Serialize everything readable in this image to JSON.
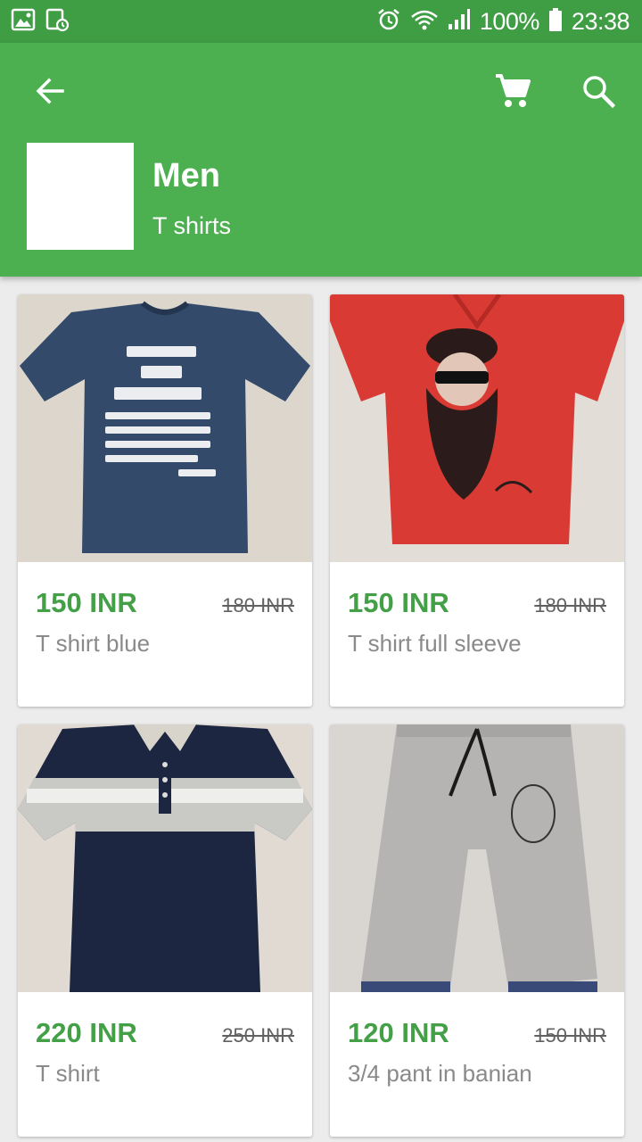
{
  "status_bar": {
    "battery": "100%",
    "time": "23:38"
  },
  "app_bar": {
    "title": "Men",
    "subtitle": "T shirts"
  },
  "products": [
    {
      "price": "150 INR",
      "old_price": "180 INR",
      "name": "T shirt blue"
    },
    {
      "price": "150 INR",
      "old_price": "180 INR",
      "name": "T shirt full sleeve"
    },
    {
      "price": "220 INR",
      "old_price": "250 INR",
      "name": "T shirt"
    },
    {
      "price": "120 INR",
      "old_price": "150 INR",
      "name": "3/4 pant in banian"
    }
  ],
  "colors": {
    "primary": "#4caf50",
    "primary_dark": "#3f9d44",
    "price_green": "#43a047"
  }
}
